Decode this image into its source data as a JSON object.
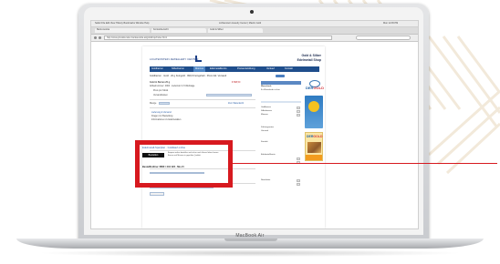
{
  "browser": {
    "menubar_left": "Safari  File  Edit  View  History  Bookmarks  Window  Help",
    "menubar_center": "Lichtenstein Jewelry Center | Maxim Gold",
    "menubar_right": "Mon 12:45 PM",
    "tab_labels": [
      "Bank Austria",
      "Kontoübersicht",
      "Gold & Silber"
    ],
    "address": "http://www.privatkunden.bankaustria.at/goldshop/index.html"
  },
  "page": {
    "logo": "LICHTENSTEIN JEWELLERY CENTER",
    "title_lines": [
      "Gold & Silber",
      "Edelmetall Shop"
    ],
    "nav_items": [
      "Goldbarren",
      "Silberbarren",
      "Münzen",
      "Edelmetallkonto",
      "Preisentwicklung",
      "Verkauf",
      "Kontakt"
    ],
    "active_nav_index": 2,
    "breadcrumb": "Goldbarren · Gold · 20 g Feingold · 999,9 Feingehalt · Preis inkl. Versand",
    "left_lines": [
      "Gold in Barren  20 g",
      "Artikelnummer: 4004 · Lieferzeit 3–5 Werktage",
      "Preis pro Stück",
      "Versandkosten",
      "Menge",
      "Zum Warenkorb",
      "Lieferung & Versand",
      "Fragen zur Bestellung",
      "Informationen zu Edelmetallen"
    ],
    "price": "€ 898,50",
    "right_panel": {
      "head": "Warenkorb",
      "rows": [
        "Ihr Warenkorb ist leer",
        "Goldbarren",
        "Silberbarren",
        "Münzen",
        "Zahlungsarten",
        "Versand",
        "Kontakt",
        "Edelmetallkonto",
        "Newsletter"
      ]
    },
    "ad_brand": "DER",
    "ad_brand_accent": "GOLD"
  },
  "highlight": {
    "title": "Edelmetall-Sparplan · Goldkauf online",
    "button": "Bestellen",
    "description": "Bequem online bestellen und sicher nach Hause liefern lassen. Barren und Münzen in geprüfter Qualität.",
    "footer": "Bestellhotline: 0800 / 444 123 · Mo–Fr"
  },
  "laptop_brand": "MacBook Air",
  "colors": {
    "nav_blue": "#1f4e8c",
    "highlight_red": "#d7191f"
  }
}
